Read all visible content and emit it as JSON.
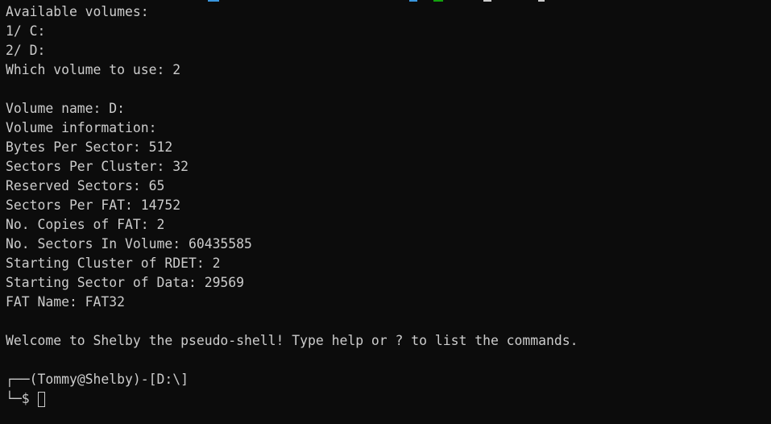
{
  "terminal": {
    "output_lines": [
      "Available volumes:",
      "1/ C:",
      "2/ D:",
      "Which volume to use: 2",
      "",
      "Volume name: D:",
      "Volume information:",
      "Bytes Per Sector: 512",
      "Sectors Per Cluster: 32",
      "Reserved Sectors: 65",
      "Sectors Per FAT: 14752",
      "No. Copies of FAT: 2",
      "No. Sectors In Volume: 60435585",
      "Starting Cluster of RDET: 2",
      "Starting Sector of Data: 29569",
      "FAT Name: FAT32",
      "",
      "Welcome to Shelby the pseudo-shell! Type help or ? to list the commands.",
      ""
    ],
    "prompt": {
      "line1_prefix": "┌──",
      "user_host": "(Tommy@Shelby)",
      "separator": "-",
      "path": "[D:\\]",
      "line2_prefix": "└─",
      "symbol": "$"
    }
  },
  "colors": {
    "background": "#0c0c0c",
    "foreground": "#cccccc",
    "top_strip_accents": [
      "#3a96dd",
      "#13a10e",
      "#cccccc"
    ]
  }
}
